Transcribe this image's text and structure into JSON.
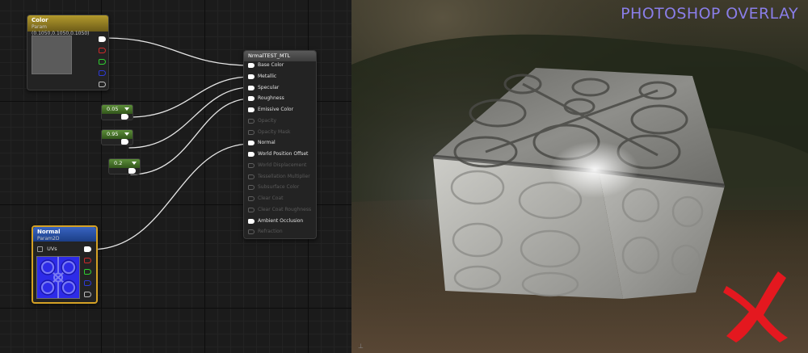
{
  "graph": {
    "color_node": {
      "title": "Color",
      "subtitle": "Param (0.1050,0.1050,0.1050)",
      "pin_colors": [
        "#ffffff",
        "#cc2a2a",
        "#2fcf2f",
        "#2d3ad6",
        "#bdbdbd"
      ],
      "header_color": "#9c8426"
    },
    "scalar_nodes": [
      {
        "value": "0.05"
      },
      {
        "value": "0.95"
      },
      {
        "value": "0.2"
      }
    ],
    "normal_node": {
      "title": "Normal",
      "subtitle": "Param2D",
      "uv_label": "UVs",
      "pin_colors": [
        "#ffffff",
        "#cc2a2a",
        "#2fcf2f",
        "#2d3ad6",
        "#bdbdbd"
      ],
      "header_color": "#2c54a8"
    },
    "material_node": {
      "title": "NrmalTEST_MTL",
      "inputs": [
        {
          "label": "Base Color",
          "enabled": true
        },
        {
          "label": "Metallic",
          "enabled": true
        },
        {
          "label": "Specular",
          "enabled": true
        },
        {
          "label": "Roughness",
          "enabled": true
        },
        {
          "label": "Emissive Color",
          "enabled": true
        },
        {
          "label": "Opacity",
          "enabled": false
        },
        {
          "label": "Opacity Mask",
          "enabled": false
        },
        {
          "label": "Normal",
          "enabled": true
        },
        {
          "label": "World Position Offset",
          "enabled": true
        },
        {
          "label": "World Displacement",
          "enabled": false
        },
        {
          "label": "Tessellation Multiplier",
          "enabled": false
        },
        {
          "label": "Subsurface Color",
          "enabled": false
        },
        {
          "label": "Clear Coat",
          "enabled": false
        },
        {
          "label": "Clear Coat Roughness",
          "enabled": false
        },
        {
          "label": "Ambient Occlusion",
          "enabled": true
        },
        {
          "label": "Refraction",
          "enabled": false
        }
      ]
    },
    "wire_color": "#e6e6e6"
  },
  "viewport": {
    "overlay_text": "PHOTOSHOP OVERLAY",
    "overlay_color": "#8a7ee8",
    "x_mark_color": "#e4181f",
    "axis_label": "⊥"
  }
}
